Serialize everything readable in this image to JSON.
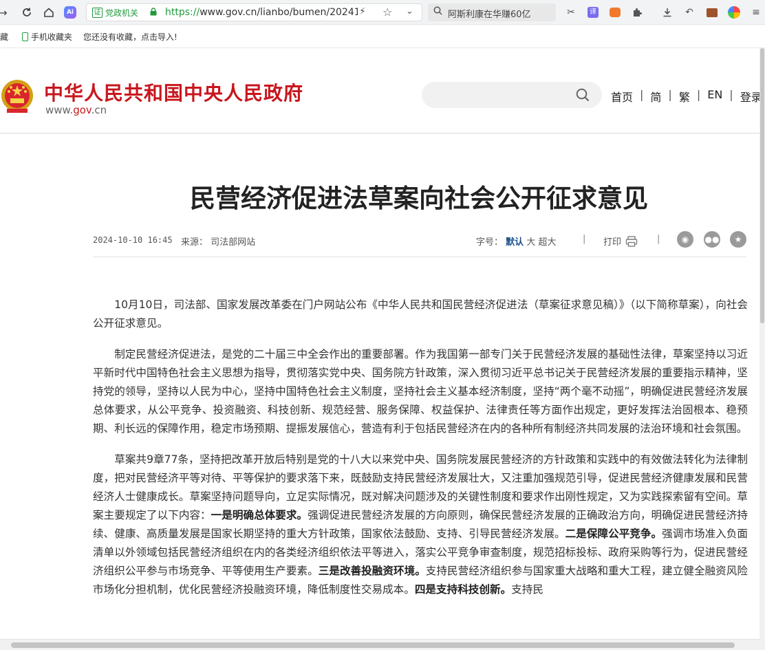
{
  "browser": {
    "badge_label": "党政机关",
    "badge_mark": "证",
    "url_protocol": "https://",
    "url_rest": "www.gov.cn/lianbo/bumen/20241",
    "search_text": "阿斯利康在华赚60亿",
    "ai_label": "Ai",
    "translate_label": "译"
  },
  "bookmarks": {
    "edge_label": "藏",
    "mobile_label": "手机收藏夹",
    "import_hint": "您还没有收藏，点击导入!"
  },
  "site": {
    "title": "中华人民共和国中央人民政府",
    "domain_prefix": "www.",
    "domain_main": "gov",
    "domain_suffix": ".cn",
    "nav": [
      "首页",
      "简",
      "繁",
      "EN",
      "登录"
    ]
  },
  "article": {
    "title": "民营经济促进法草案向社会公开征求意见",
    "date": "2024-10-10 16:45",
    "source_label": "来源：",
    "source": "司法部网站",
    "font_label": "字号：",
    "font_default": "默认",
    "font_large": "大",
    "font_xlarge": "超大",
    "print_label": "打印",
    "separator": "|",
    "p1": "10月10日，司法部、国家发展改革委在门户网站公布《中华人民共和国民营经济促进法（草案征求意见稿）》（以下简称草案），向社会公开征求意见。",
    "p2": "制定民营经济促进法，是党的二十届三中全会作出的重要部署。作为我国第一部专门关于民营经济发展的基础性法律，草案坚持以习近平新时代中国特色社会主义思想为指导，贯彻落实党中央、国务院方针政策，深入贯彻习近平总书记关于民营经济发展的重要指示精神，坚持党的领导，坚持以人民为中心，坚持中国特色社会主义制度，坚持社会主义基本经济制度，坚持“两个毫不动摇”，明确促进民营经济发展总体要求，从公平竞争、投资融资、科技创新、规范经营、服务保障、权益保护、法律责任等方面作出规定，更好发挥法治固根本、稳预期、利长远的保障作用，稳定市场预期、提振发展信心，营造有利于包括民营经济在内的各种所有制经济共同发展的法治环境和社会氛围。",
    "p3_a": "草案共9章77条，坚持把改革开放后特别是党的十八大以来党中央、国务院发展民营经济的方针政策和实践中的有效做法转化为法律制度，把对民营经济平等对待、平等保护的要求落下来，既鼓励支持民营经济发展壮大，又注重加强规范引导，促进民营经济健康发展和民营经济人士健康成长。草案坚持问题导向，立足实际情况，既对解决问题涉及的关键性制度和要求作出刚性规定，又为实践探索留有空间。草案主要规定了以下内容：",
    "p3_b1": "一是明确总体要求。",
    "p3_c": "强调促进民营经济发展的方向原则，确保民营经济发展的正确政治方向，明确促进民营经济持续、健康、高质量发展是国家长期坚持的重大方针政策，国家依法鼓励、支持、引导民营经济发展。",
    "p3_b2": "二是保障公平竞争。",
    "p3_d": "强调市场准入负面清单以外领域包括民营经济组织在内的各类经济组织依法平等进入，落实公平竞争审查制度，规范招标投标、政府采购等行为，促进民营经济组织公平参与市场竞争、平等使用生产要素。",
    "p3_b3": "三是改善投融资环境。",
    "p3_e": "支持民营经济组织参与国家重大战略和重大工程，建立健全融资风险市场化分担机制，优化民营经济投融资环境，降低制度性交易成本。",
    "p3_b4": "四是支持科技创新。",
    "p3_f": "支持民"
  }
}
